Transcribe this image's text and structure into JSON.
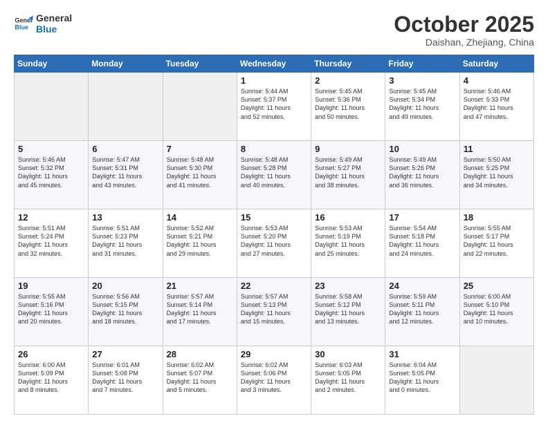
{
  "logo": {
    "line1": "General",
    "line2": "Blue"
  },
  "title": "October 2025",
  "subtitle": "Daishan, Zhejiang, China",
  "days_of_week": [
    "Sunday",
    "Monday",
    "Tuesday",
    "Wednesday",
    "Thursday",
    "Friday",
    "Saturday"
  ],
  "weeks": [
    [
      {
        "day": "",
        "info": ""
      },
      {
        "day": "",
        "info": ""
      },
      {
        "day": "",
        "info": ""
      },
      {
        "day": "1",
        "info": "Sunrise: 5:44 AM\nSunset: 5:37 PM\nDaylight: 11 hours\nand 52 minutes."
      },
      {
        "day": "2",
        "info": "Sunrise: 5:45 AM\nSunset: 5:36 PM\nDaylight: 11 hours\nand 50 minutes."
      },
      {
        "day": "3",
        "info": "Sunrise: 5:45 AM\nSunset: 5:34 PM\nDaylight: 11 hours\nand 49 minutes."
      },
      {
        "day": "4",
        "info": "Sunrise: 5:46 AM\nSunset: 5:33 PM\nDaylight: 11 hours\nand 47 minutes."
      }
    ],
    [
      {
        "day": "5",
        "info": "Sunrise: 5:46 AM\nSunset: 5:32 PM\nDaylight: 11 hours\nand 45 minutes."
      },
      {
        "day": "6",
        "info": "Sunrise: 5:47 AM\nSunset: 5:31 PM\nDaylight: 11 hours\nand 43 minutes."
      },
      {
        "day": "7",
        "info": "Sunrise: 5:48 AM\nSunset: 5:30 PM\nDaylight: 11 hours\nand 41 minutes."
      },
      {
        "day": "8",
        "info": "Sunrise: 5:48 AM\nSunset: 5:28 PM\nDaylight: 11 hours\nand 40 minutes."
      },
      {
        "day": "9",
        "info": "Sunrise: 5:49 AM\nSunset: 5:27 PM\nDaylight: 11 hours\nand 38 minutes."
      },
      {
        "day": "10",
        "info": "Sunrise: 5:49 AM\nSunset: 5:26 PM\nDaylight: 11 hours\nand 36 minutes."
      },
      {
        "day": "11",
        "info": "Sunrise: 5:50 AM\nSunset: 5:25 PM\nDaylight: 11 hours\nand 34 minutes."
      }
    ],
    [
      {
        "day": "12",
        "info": "Sunrise: 5:51 AM\nSunset: 5:24 PM\nDaylight: 11 hours\nand 32 minutes."
      },
      {
        "day": "13",
        "info": "Sunrise: 5:51 AM\nSunset: 5:23 PM\nDaylight: 11 hours\nand 31 minutes."
      },
      {
        "day": "14",
        "info": "Sunrise: 5:52 AM\nSunset: 5:21 PM\nDaylight: 11 hours\nand 29 minutes."
      },
      {
        "day": "15",
        "info": "Sunrise: 5:53 AM\nSunset: 5:20 PM\nDaylight: 11 hours\nand 27 minutes."
      },
      {
        "day": "16",
        "info": "Sunrise: 5:53 AM\nSunset: 5:19 PM\nDaylight: 11 hours\nand 25 minutes."
      },
      {
        "day": "17",
        "info": "Sunrise: 5:54 AM\nSunset: 5:18 PM\nDaylight: 11 hours\nand 24 minutes."
      },
      {
        "day": "18",
        "info": "Sunrise: 5:55 AM\nSunset: 5:17 PM\nDaylight: 11 hours\nand 22 minutes."
      }
    ],
    [
      {
        "day": "19",
        "info": "Sunrise: 5:55 AM\nSunset: 5:16 PM\nDaylight: 11 hours\nand 20 minutes."
      },
      {
        "day": "20",
        "info": "Sunrise: 5:56 AM\nSunset: 5:15 PM\nDaylight: 11 hours\nand 18 minutes."
      },
      {
        "day": "21",
        "info": "Sunrise: 5:57 AM\nSunset: 5:14 PM\nDaylight: 11 hours\nand 17 minutes."
      },
      {
        "day": "22",
        "info": "Sunrise: 5:57 AM\nSunset: 5:13 PM\nDaylight: 11 hours\nand 15 minutes."
      },
      {
        "day": "23",
        "info": "Sunrise: 5:58 AM\nSunset: 5:12 PM\nDaylight: 11 hours\nand 13 minutes."
      },
      {
        "day": "24",
        "info": "Sunrise: 5:59 AM\nSunset: 5:11 PM\nDaylight: 11 hours\nand 12 minutes."
      },
      {
        "day": "25",
        "info": "Sunrise: 6:00 AM\nSunset: 5:10 PM\nDaylight: 11 hours\nand 10 minutes."
      }
    ],
    [
      {
        "day": "26",
        "info": "Sunrise: 6:00 AM\nSunset: 5:09 PM\nDaylight: 11 hours\nand 8 minutes."
      },
      {
        "day": "27",
        "info": "Sunrise: 6:01 AM\nSunset: 5:08 PM\nDaylight: 11 hours\nand 7 minutes."
      },
      {
        "day": "28",
        "info": "Sunrise: 6:02 AM\nSunset: 5:07 PM\nDaylight: 11 hours\nand 5 minutes."
      },
      {
        "day": "29",
        "info": "Sunrise: 6:02 AM\nSunset: 5:06 PM\nDaylight: 11 hours\nand 3 minutes."
      },
      {
        "day": "30",
        "info": "Sunrise: 6:03 AM\nSunset: 5:05 PM\nDaylight: 11 hours\nand 2 minutes."
      },
      {
        "day": "31",
        "info": "Sunrise: 6:04 AM\nSunset: 5:05 PM\nDaylight: 11 hours\nand 0 minutes."
      },
      {
        "day": "",
        "info": ""
      }
    ]
  ]
}
